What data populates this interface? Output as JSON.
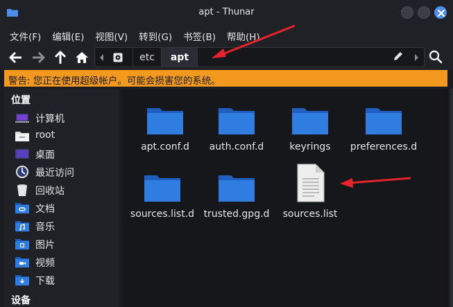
{
  "window": {
    "title": "apt - Thunar"
  },
  "menu": [
    "文件(F)",
    "编辑(E)",
    "视图(V)",
    "转到(G)",
    "书签(B)",
    "帮助(H)"
  ],
  "path": {
    "etc": "etc",
    "apt": "apt"
  },
  "warning": "警告: 您正在使用超级帐户。可能会损害您的系统。",
  "sidebar": {
    "places_title": "位置",
    "places": [
      {
        "label": "计算机",
        "icon": "computer-icon"
      },
      {
        "label": "root",
        "icon": "home-folder-icon"
      },
      {
        "label": "桌面",
        "icon": "desktop-icon"
      },
      {
        "label": "最近访问",
        "icon": "recent-icon"
      },
      {
        "label": "回收站",
        "icon": "trash-icon"
      },
      {
        "label": "文档",
        "icon": "documents-folder-icon"
      },
      {
        "label": "音乐",
        "icon": "music-folder-icon"
      },
      {
        "label": "图片",
        "icon": "pictures-folder-icon"
      },
      {
        "label": "视频",
        "icon": "videos-folder-icon"
      },
      {
        "label": "下载",
        "icon": "downloads-folder-icon"
      }
    ],
    "devices_title": "设备"
  },
  "files": [
    {
      "name": "apt.conf.d",
      "type": "folder"
    },
    {
      "name": "auth.conf.d",
      "type": "folder"
    },
    {
      "name": "keyrings",
      "type": "folder"
    },
    {
      "name": "preferences.d",
      "type": "folder"
    },
    {
      "name": "sources.list.d",
      "type": "folder"
    },
    {
      "name": "trusted.gpg.d",
      "type": "folder"
    },
    {
      "name": "sources.list",
      "type": "text-file"
    }
  ],
  "colors": {
    "folder": "#2f7de1",
    "warning": "#f39a1e",
    "annotation": "#e8242b",
    "accent": "#4d8fe8"
  }
}
